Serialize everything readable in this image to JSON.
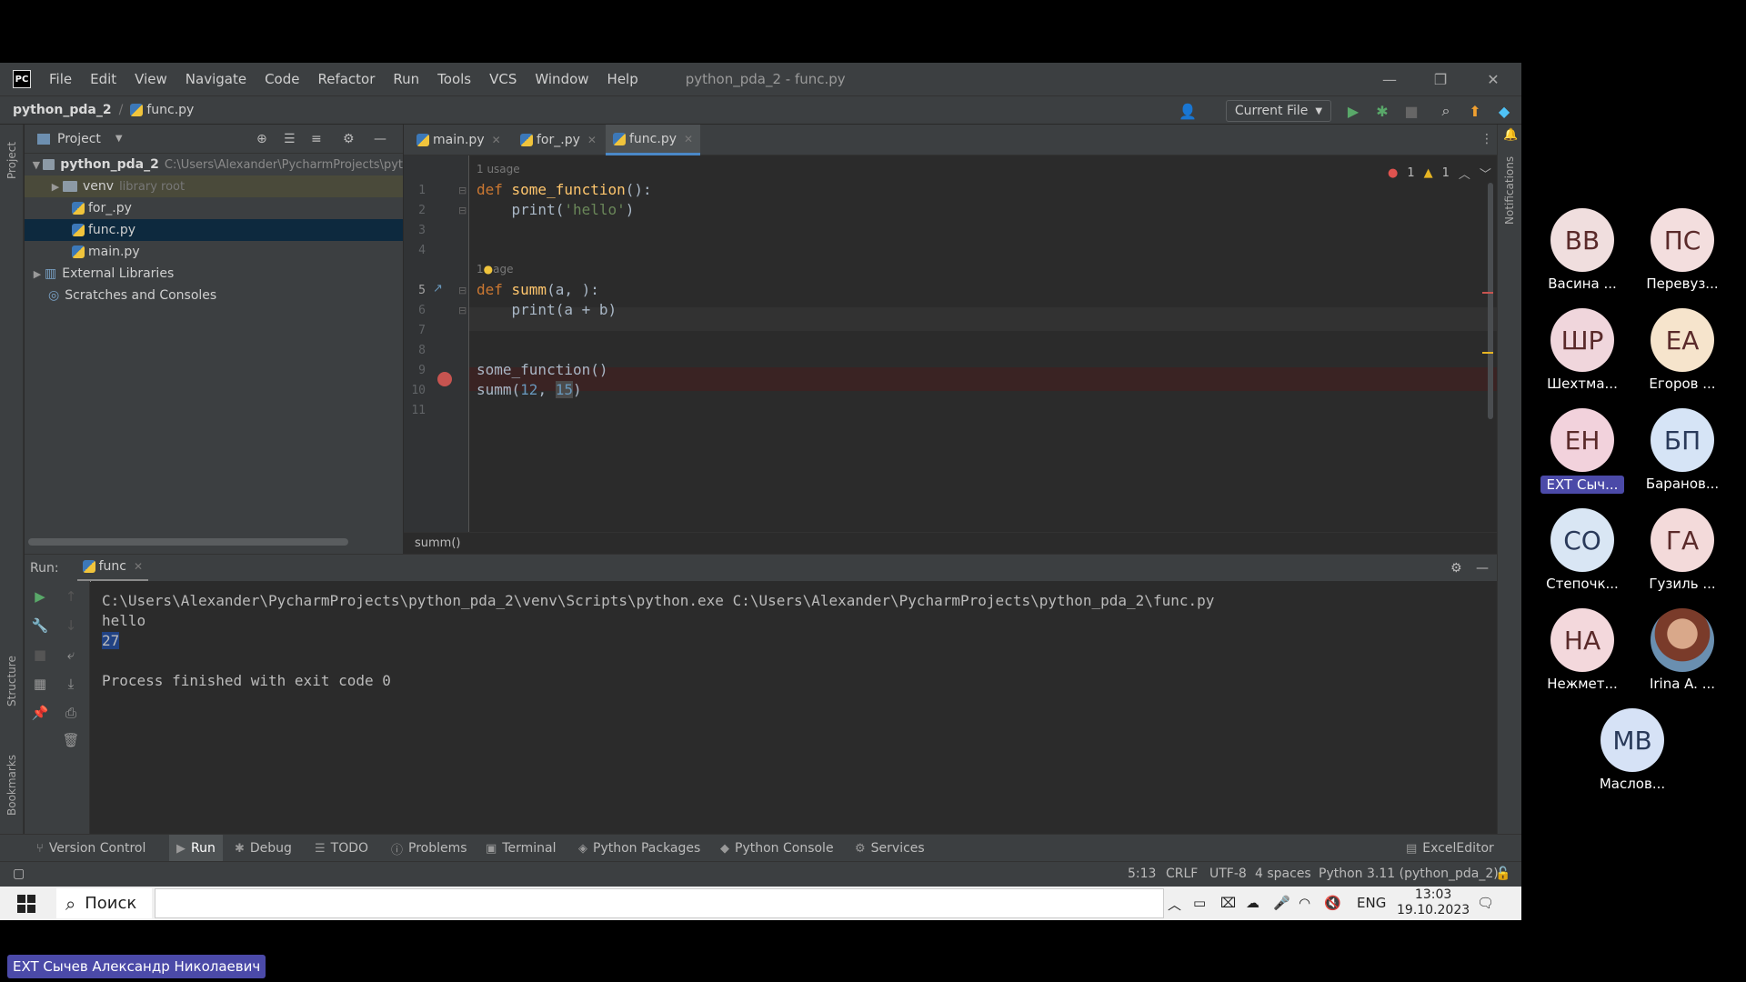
{
  "titlebar": {
    "logo": "PC",
    "menu": [
      "File",
      "Edit",
      "View",
      "Navigate",
      "Code",
      "Refactor",
      "Run",
      "Tools",
      "VCS",
      "Window",
      "Help"
    ],
    "title": "python_pda_2 - func.py",
    "minimize": "—",
    "restore": "❐",
    "close": "✕"
  },
  "navbar": {
    "project": "python_pda_2",
    "file": "func.py",
    "run_config": "Current File"
  },
  "project_panel": {
    "header": "Project",
    "tree": [
      {
        "label": "python_pda_2",
        "path": "C:\\Users\\Alexander\\PycharmProjects\\pyt"
      },
      {
        "label": "venv",
        "suffix": "library root"
      },
      {
        "label": "for_.py"
      },
      {
        "label": "func.py"
      },
      {
        "label": "main.py"
      },
      {
        "label": "External Libraries"
      },
      {
        "label": "Scratches and Consoles"
      }
    ]
  },
  "left_stripe": {
    "project": "Project",
    "structure": "Structure",
    "bookmarks": "Bookmarks"
  },
  "right_stripe": {
    "notifications": "Notifications"
  },
  "tabs": [
    {
      "label": "main.py"
    },
    {
      "label": "for_.py"
    },
    {
      "label": "func.py"
    }
  ],
  "editor": {
    "inspections": {
      "errors": "1",
      "warnings": "1"
    },
    "line_numbers": [
      "1",
      "2",
      "3",
      "4",
      "5",
      "6",
      "7",
      "8",
      "9",
      "10",
      "11"
    ],
    "usage_hint_1": "1 usage",
    "usage_hint_2": "1",
    "usage_hint_2_end": "age",
    "code": {
      "l1_kw": "def ",
      "l1_fn": "some_function",
      "l1_rest": "():",
      "l2_a": "    print(",
      "l2_str": "'hello'",
      "l2_b": ")",
      "l5_kw": "def ",
      "l5_fn": "summ",
      "l5_rest": "(a, ):",
      "l6": "    print(a + b)",
      "l9": "some_function()",
      "l10_a": "summ(",
      "l10_n1": "12",
      "l10_sep": ", ",
      "l10_n2": "15",
      "l10_b": ")"
    },
    "breadcrumb": "summ()"
  },
  "run_panel": {
    "label": "Run:",
    "tab": "func",
    "output": [
      "C:\\Users\\Alexander\\PycharmProjects\\python_pda_2\\venv\\Scripts\\python.exe C:\\Users\\Alexander\\PycharmProjects\\python_pda_2\\func.py",
      "hello",
      "27",
      "Process finished with exit code 0"
    ]
  },
  "tool_tabs": [
    "Version Control",
    "Run",
    "Debug",
    "TODO",
    "Problems",
    "Terminal",
    "Python Packages",
    "Python Console",
    "Services"
  ],
  "excel_editor": "ExcelEditor",
  "status": {
    "position": "5:13",
    "line_sep": "CRLF",
    "encoding": "UTF-8",
    "indent": "4 spaces",
    "interpreter": "Python 3.11 (python_pda_2)"
  },
  "taskbar": {
    "search": "Поиск",
    "lang": "ENG",
    "time": "13:03",
    "date": "19.10.2023"
  },
  "participants": [
    {
      "initials": "ВВ",
      "name": "Васина ..."
    },
    {
      "initials": "ПС",
      "name": "Перевуз..."
    },
    {
      "initials": "ШР",
      "name": "Шехтма..."
    },
    {
      "initials": "ЕА",
      "name": "Егоров ..."
    },
    {
      "initials": "ЕН",
      "name": "EXT Сыч..."
    },
    {
      "initials": "БП",
      "name": "Баранов..."
    },
    {
      "initials": "СО",
      "name": "Степочк..."
    },
    {
      "initials": "ГА",
      "name": "Гузиль ..."
    },
    {
      "initials": "НА",
      "name": "Нежмет..."
    },
    {
      "initials": "",
      "name": "Irina A. ..."
    },
    {
      "initials": "МВ",
      "name": "Маслов..."
    }
  ],
  "presenter": "EXT Сычев Александр Николаевич"
}
